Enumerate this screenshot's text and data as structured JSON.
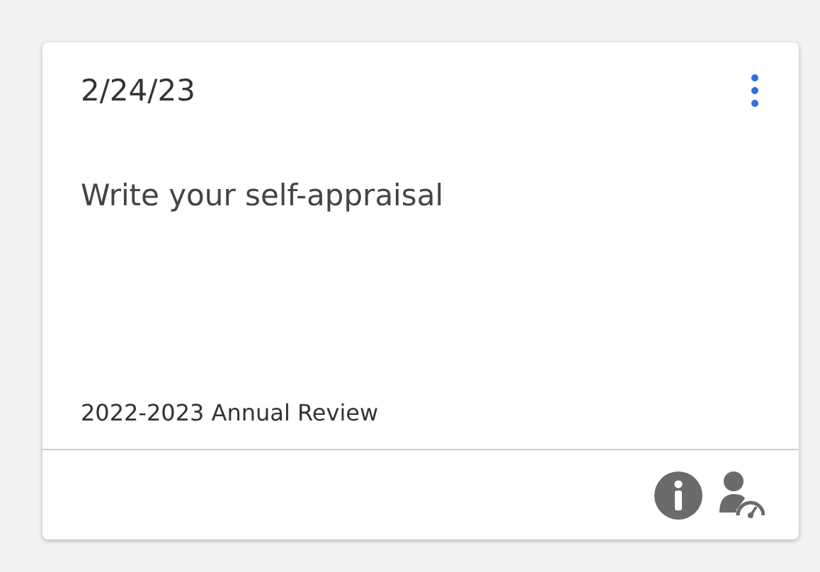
{
  "card": {
    "date": "2/24/23",
    "task": "Write your self-appraisal",
    "review": "2022-2023 Annual Review"
  }
}
